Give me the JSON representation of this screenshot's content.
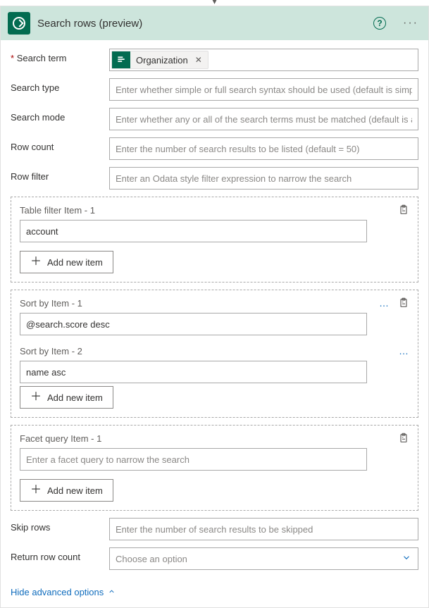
{
  "header": {
    "title": "Search rows (preview)"
  },
  "fields": {
    "search_term": {
      "label": "Search term",
      "token": "Organization"
    },
    "search_type": {
      "label": "Search type",
      "placeholder": "Enter whether simple or full search syntax should be used (default is simple)"
    },
    "search_mode": {
      "label": "Search mode",
      "placeholder": "Enter whether any or all of the search terms must be matched (default is any)"
    },
    "row_count": {
      "label": "Row count",
      "placeholder": "Enter the number of search results to be listed (default = 50)"
    },
    "row_filter": {
      "label": "Row filter",
      "placeholder": "Enter an Odata style filter expression to narrow the search"
    },
    "skip_rows": {
      "label": "Skip rows",
      "placeholder": "Enter the number of search results to be skipped"
    },
    "return_row": {
      "label": "Return row count",
      "placeholder": "Choose an option"
    }
  },
  "groups": {
    "table_filter": {
      "label1": "Table filter Item - 1",
      "val1": "account",
      "add": "Add new item"
    },
    "sort_by": {
      "label1": "Sort by Item - 1",
      "val1": "@search.score desc",
      "label2": "Sort by Item - 2",
      "val2": "name asc",
      "add": "Add new item"
    },
    "facet": {
      "label1": "Facet query Item - 1",
      "placeholder1": "Enter a facet query to narrow the search",
      "add": "Add new item"
    }
  },
  "advanced_toggle": "Hide advanced options"
}
